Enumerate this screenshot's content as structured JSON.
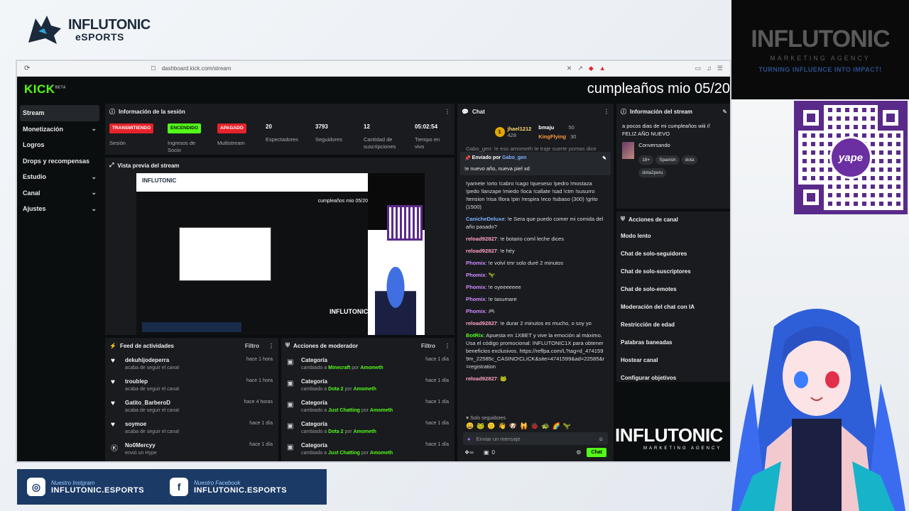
{
  "overlay": {
    "brand_top_line1": "INFLUTONIC",
    "brand_top_line2": "eSPORTS",
    "agency_name": "INFLUTONIC",
    "agency_sub": "MARKETING AGENCY",
    "agency_tagline": "TURNING INFLUENCE INTO IMPACT!",
    "qr_label": "yape",
    "bottom_brand": "INFLUTONIC",
    "bottom_brand_sub": "MARKETING AGENCY",
    "stream_title": "cumpleaños mio 05/20",
    "social": [
      {
        "label": "Nuestro Instgram",
        "handle": "INFLUTONIC.ESPORTS",
        "icon": "instagram-icon"
      },
      {
        "label": "Nuestro Facebook",
        "handle": "INFLUTONIC.ESPORTS",
        "icon": "facebook-icon"
      }
    ]
  },
  "browser": {
    "url": "dashboard.kick.com/stream"
  },
  "kick": {
    "logo": "KICK",
    "logo_badge": "BETA",
    "sidebar": [
      {
        "label": "Stream",
        "chevron": false,
        "active": true
      },
      {
        "label": "Monetización",
        "chevron": true,
        "active": false
      },
      {
        "label": "Logros",
        "chevron": false,
        "active": false
      },
      {
        "label": "Drops y recompensas",
        "chevron": false,
        "active": false
      },
      {
        "label": "Estudio",
        "chevron": true,
        "active": false
      },
      {
        "label": "Canal",
        "chevron": true,
        "active": false
      },
      {
        "label": "Ajustes",
        "chevron": true,
        "active": false
      }
    ],
    "session": {
      "title": "Información de la sesión",
      "badges": [
        {
          "text": "TRANSMITIENDO",
          "label": "Sesión",
          "color": "#e5232b"
        },
        {
          "text": "ENCENDIDO",
          "label": "Ingresos de Socio",
          "color": "#53fc18"
        },
        {
          "text": "APAGADO",
          "label": "Multistream",
          "color": "#e5232b"
        }
      ],
      "stats": [
        {
          "value": "20",
          "label": "Espectadores"
        },
        {
          "value": "3793",
          "label": "Seguidores"
        },
        {
          "value": "12",
          "label": "Cantidad de suscripciones"
        },
        {
          "value": "05:02:54",
          "label": "Tiempo en vivo"
        }
      ]
    },
    "preview": {
      "title": "Vista previa del stream",
      "inner_title": "cumpleaños mio 05/20",
      "inner_brand": "INFLUTONIC"
    },
    "feed": {
      "title": "Feed de actividades",
      "filter": "Filtro",
      "rows": [
        {
          "user": "dekuhijodeperra",
          "sub": "acaba de seguir el canal",
          "time": "hace 1 hora",
          "icon": "heart-icon"
        },
        {
          "user": "troublep",
          "sub": "acaba de seguir el canal",
          "time": "hace 1 hora",
          "icon": "heart-icon"
        },
        {
          "user": "Gatito_BarberoD",
          "sub": "acaba de seguir el canal",
          "time": "hace 4 horas",
          "icon": "heart-icon"
        },
        {
          "user": "soymoe",
          "sub": "acaba de seguir el canal",
          "time": "hace 1 día",
          "icon": "heart-icon"
        },
        {
          "user": "No0Mercyy",
          "sub": "envió un Hype",
          "time": "hace 1 día",
          "icon": "kick-icon"
        }
      ]
    },
    "mod": {
      "title": "Acciones de moderador",
      "filter": "Filtro",
      "rows": [
        {
          "title": "Categoría",
          "pre": "cambiado a",
          "cat": "Minecraft",
          "mid": "por",
          "by": "Amometh",
          "time": "hace 1 día"
        },
        {
          "title": "Categoría",
          "pre": "cambiado a",
          "cat": "Dota 2",
          "mid": "por",
          "by": "Amometh",
          "time": "hace 1 día"
        },
        {
          "title": "Categoría",
          "pre": "cambiado a",
          "cat": "Just Chatting",
          "mid": "por",
          "by": "Amometh",
          "time": "hace 1 día"
        },
        {
          "title": "Categoría",
          "pre": "cambiado a",
          "cat": "Dota 2",
          "mid": "por",
          "by": "Amometh",
          "time": "hace 1 día"
        },
        {
          "title": "Categoría",
          "pre": "cambiado a",
          "cat": "Just Chatting",
          "mid": "por",
          "by": "Amometh",
          "time": "hace 1 día"
        }
      ]
    },
    "chat": {
      "title": "Chat",
      "top": [
        {
          "rank": "1",
          "name": "jhael1212",
          "amount": "428"
        },
        {
          "name": "bmaju",
          "amount": "50"
        },
        {
          "name": "KingFlying",
          "amount": "30"
        }
      ],
      "pinned_by_label": "Enviado por",
      "pinned_by": "Gabo_gen",
      "pinned_text": "!e nuevo año, nueva piel xd",
      "preview_line": "Gabo_gen: !e eso amometh te traje suerte pomas dice",
      "commands": "!yamete !orto !cabro !cago !queseso !pedro !mostaza !pedo !lanzape !miedo !loca !callate !sad !ctm !susurro !tension !risa !llora !pin !respira !eco !tubaso (300) !grito (1500)",
      "messages": [
        {
          "name": "CanicheDeluxe",
          "color": "#7fb2ff",
          "text": "!e Sera que puedo comer mi comida del año pasado?"
        },
        {
          "name": "reload92827",
          "color": "#ffa0c0",
          "text": "!e botario coml leche dices"
        },
        {
          "name": "reload92827",
          "color": "#ffa0c0",
          "text": "!e héy"
        },
        {
          "name": "Phomix",
          "color": "#d08cff",
          "text": "!e volví tmr solo duré 2 minutos"
        },
        {
          "name": "Phomix",
          "color": "#d08cff",
          "text": "🦖"
        },
        {
          "name": "Phomix",
          "color": "#d08cff",
          "text": "!e oyeeeeeee"
        },
        {
          "name": "Phomix",
          "color": "#d08cff",
          "text": "!e tasumare"
        },
        {
          "name": "Phomix",
          "color": "#d08cff",
          "text": "🎮"
        },
        {
          "name": "reload92827",
          "color": "#ffa0c0",
          "text": "!e durar 2 minutos es mucho, o soy yo"
        },
        {
          "name": "BotRix",
          "color": "#53fc18",
          "text": "Apuesta en 1XBET y vive la emoción al máximo. Usa el código promocional: INFLUTONIC1X para obtener beneficios exclusivos. https://reffpa.com/L?tag=d_4741599m_22585c_CASINO!CLICK&site=4741599&ad=22585&r=registration"
        },
        {
          "name": "reload92827",
          "color": "#ffa0c0",
          "text": "🐸"
        }
      ],
      "followers_only": "Solo seguidores",
      "input_placeholder": "Enviar un mensaje",
      "count": "0",
      "send": "Chat"
    },
    "info": {
      "title": "Información del stream",
      "stream_title": "a pocos dias de mi cumpleaños wiii // FELIZ AÑO NUEVO",
      "category": "Conversando",
      "tags": [
        "18+",
        "Spanish",
        "dota",
        "dota2peru"
      ]
    },
    "actions": {
      "title": "Acciones de canal",
      "items": [
        "Modo lento",
        "Chat de solo-seguidores",
        "Chat de solo-suscriptores",
        "Chat de solo-emotes",
        "Moderación del chat con IA",
        "Restricción de edad",
        "Palabras baneadas",
        "Hostear canal",
        "Configurar objetivos"
      ]
    }
  }
}
